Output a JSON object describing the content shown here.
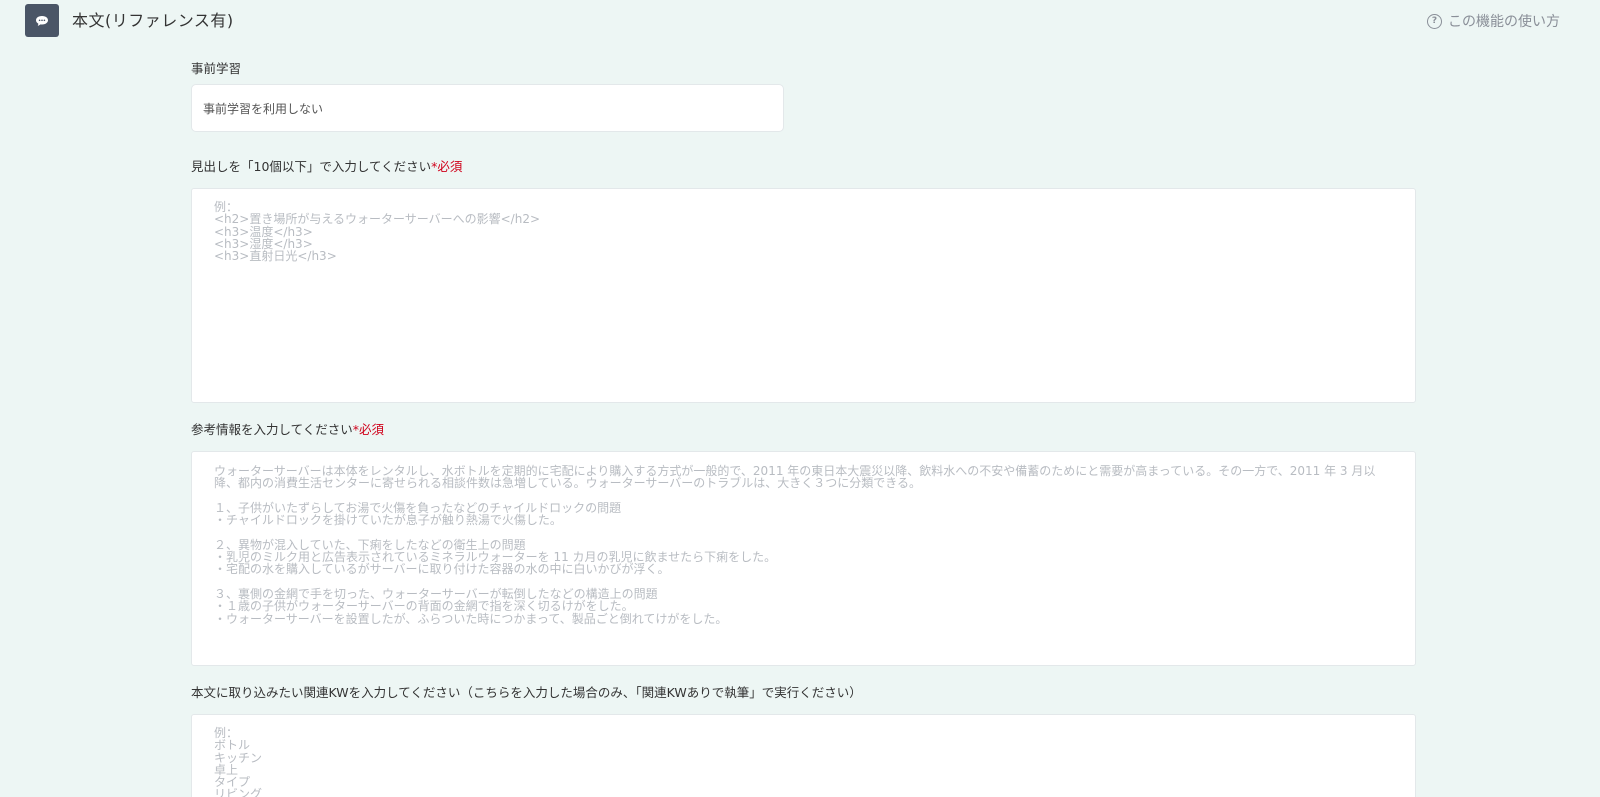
{
  "header": {
    "title": "本文(リファレンス有)",
    "icon": "chat-bubble-icon",
    "help_label": "この機能の使い方",
    "help_icon": "question-circle-icon"
  },
  "pre_learning": {
    "label": "事前学習",
    "selected_value": "事前学習を利用しない"
  },
  "headings": {
    "label": "見出しを「10個以下」で入力してください",
    "required_mark": "*必須",
    "placeholder": "例：\n<h2>置き場所が与えるウォーターサーバーへの影響</h2>\n<h3>温度</h3>\n<h3>湿度</h3>\n<h3>直射日光</h3>"
  },
  "reference": {
    "label": "参考情報を入力してください",
    "required_mark": "*必須",
    "placeholder": "ウォーターサーバーは本体をレンタルし、水ボトルを定期的に宅配により購入する方式が一般的で、2011 年の東日本大震災以降、飲料水への不安や備蓄のためにと需要が高まっている。その一方で、2011 年 3 月以降、都内の消費生活センターに寄せられる相談件数は急増している。ウォーターサーバーのトラブルは、大きく３つに分類できる。\n\n１、子供がいたずらしてお湯で火傷を負ったなどのチャイルドロックの問題\n・チャイルドロックを掛けていたが息子が触り熱湯で火傷した。\n\n２、異物が混入していた、下痢をしたなどの衛生上の問題\n・乳児のミルク用と広告表示されているミネラルウォーターを 11 カ月の乳児に飲ませたら下痢をした。\n・宅配の水を購入しているがサーバーに取り付けた容器の水の中に白いかびが浮く。\n\n３、裏側の金網で手を切った、ウォーターサーバーが転倒したなどの構造上の問題\n・１歳の子供がウォーターサーバーの背面の金網で指を深く切るけがをした。\n・ウォーターサーバーを設置したが、ふらついた時につかまって、製品ごと倒れてけがをした。"
  },
  "keywords": {
    "label": "本文に取り込みたい関連KWを入力してください（こちらを入力した場合のみ、「関連KWありで執筆」で実行ください）",
    "placeholder": "例：\nボトル\nキッチン\n卓上\nタイプ\nリビング"
  },
  "colors": {
    "background": "#edf6f4",
    "required": "#d0021b",
    "icon_bg": "#4a5566"
  }
}
